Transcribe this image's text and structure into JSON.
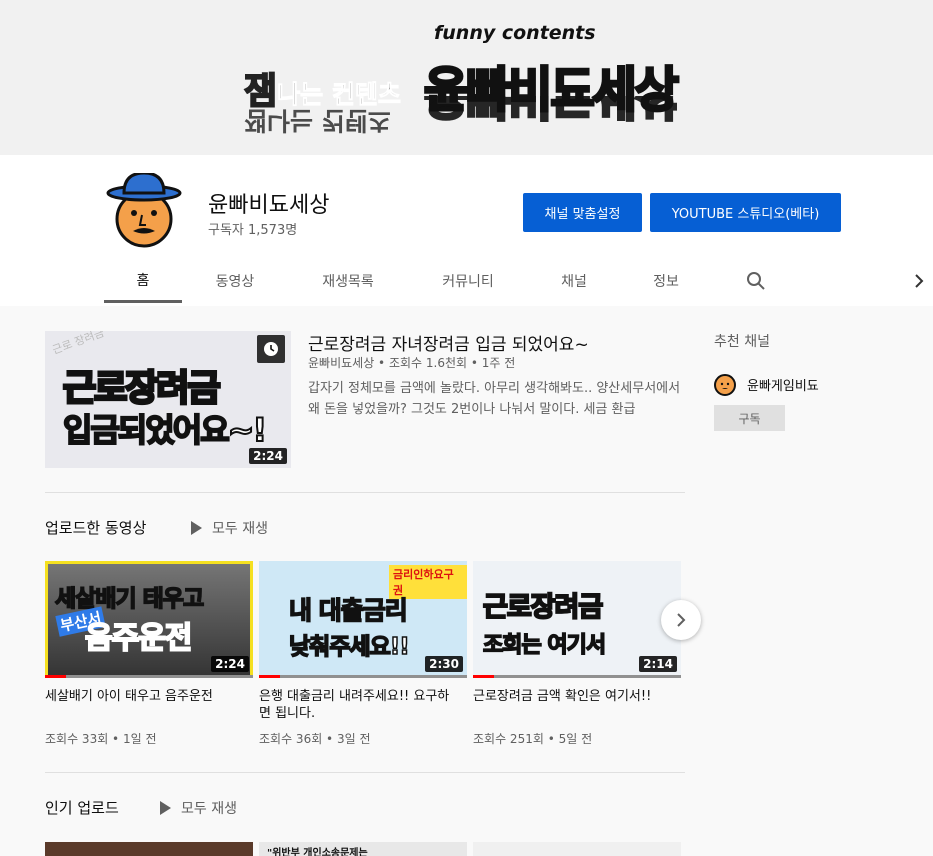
{
  "banner": {
    "tagline": "funny contents",
    "small_prefix_accent": "잼",
    "small_prefix_rest": "나는 컨텐츠",
    "big_title": "윤빠비됴세상"
  },
  "channel": {
    "name": "윤빠비됴세상",
    "subscribers": "구독자 1,573명",
    "customize_button": "채널 맞춤설정",
    "studio_button": "YOUTUBE 스튜디오(베타)"
  },
  "tabs": [
    "홈",
    "동영상",
    "재생목록",
    "커뮤니티",
    "채널",
    "정보"
  ],
  "featured": {
    "title": "근로장려금 자녀장려금 입금 되었어요~",
    "meta": "윤빠비됴세상 • 조회수 1.6천회 • 1주 전",
    "description": "갑자기 정체모를 금액에 놀랐다. 아무리 생각해봐도.. 양산세무서에서 왜 돈을 넣었을까? 그것도 2번이나 나눠서 말이다. 세금 환급",
    "duration": "2:24",
    "thumb_line1": "근로장려금",
    "thumb_line2a": "입금",
    "thumb_line2b": "되었어요~!",
    "thumb_corner": "근로 장려금"
  },
  "uploads": {
    "title": "업로드한 동영상",
    "play_all": "모두 재생",
    "videos": [
      {
        "title": "세살배기 아이 태우고 음주운전",
        "meta": "조회수 33회 • 1일 전",
        "duration": "2:24",
        "thumb_top": "세살배기 태우고",
        "thumb_tag": "부산서",
        "thumb_bottom": "음주운전"
      },
      {
        "title": "은행 대출금리 내려주세요!! 요구하면 됩니다.",
        "meta": "조회수 36회 • 3일 전",
        "duration": "2:30",
        "thumb_top": "금리인하요구권",
        "thumb_mid_a": "내",
        "thumb_mid_b": "대출금리",
        "thumb_bottom": "낮춰주세요!!"
      },
      {
        "title": "근로장려금 금액 확인은 여기서!!",
        "meta": "조회수 251회 • 5일 전",
        "duration": "2:14",
        "thumb_top": "근로장려금",
        "thumb_bottom": "조회는 여기서"
      }
    ]
  },
  "popular": {
    "title": "인기 업로드",
    "play_all": "모두 재생",
    "thumb2_caption": "\"위반부 개인소송문제는"
  },
  "sidebar": {
    "title": "추천 채널",
    "channel_name": "윤빠게임비됴",
    "subscribe": "구독"
  }
}
